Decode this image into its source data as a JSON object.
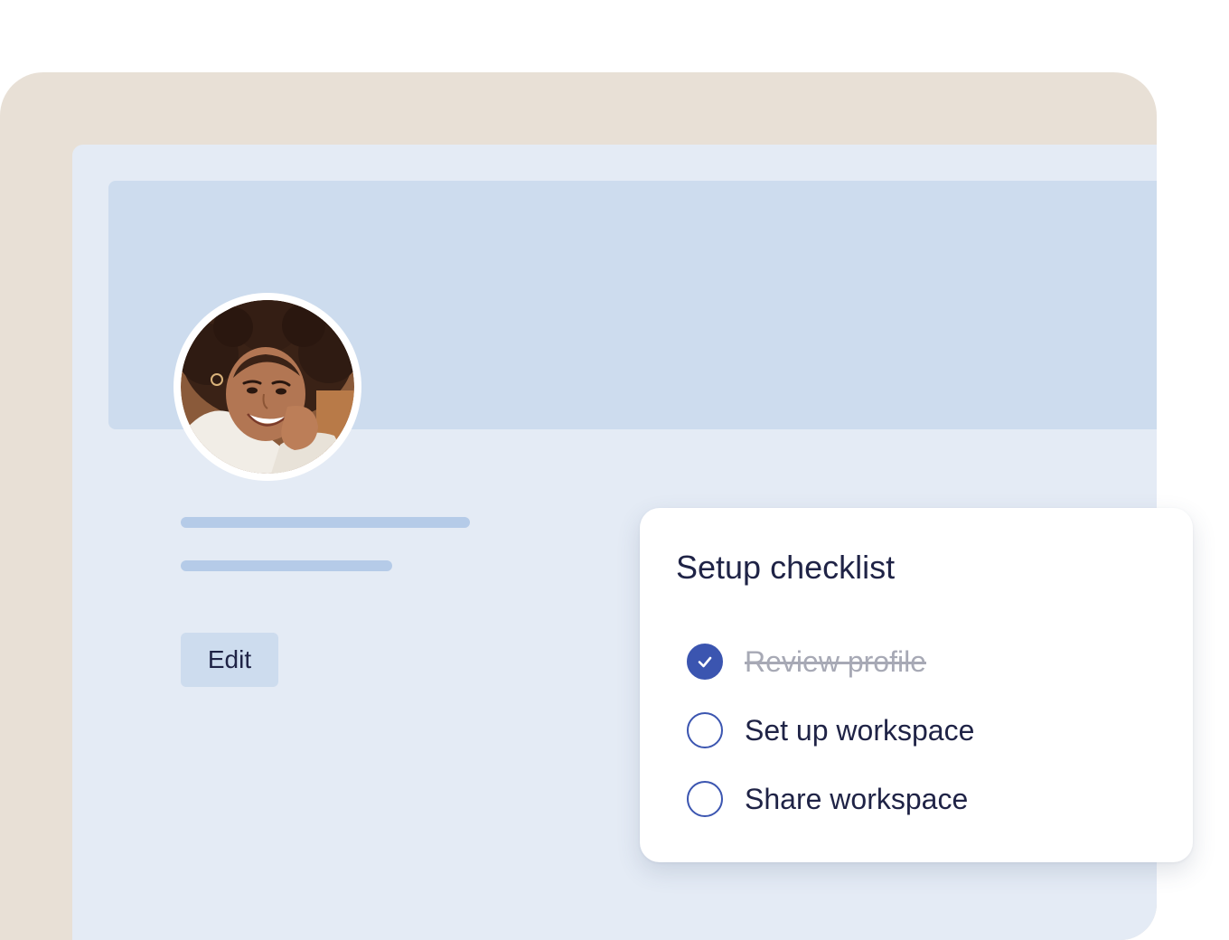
{
  "profile": {
    "avatar_icon": "user-photo-avatar",
    "edit_label": "Edit"
  },
  "checklist": {
    "title": "Setup checklist",
    "items": [
      {
        "label": "Review profile",
        "done": true,
        "icon": "check-icon"
      },
      {
        "label": "Set up workspace",
        "done": false
      },
      {
        "label": "Share workspace",
        "done": false
      }
    ]
  },
  "colors": {
    "outer_frame": "#e8e0d6",
    "app_background": "#e4ebf5",
    "cover_banner": "#cddcee",
    "placeholder_lines": "#b5cbe8",
    "accent": "#3b55b0",
    "text_primary": "#1f2346",
    "text_done": "#a7a9b5"
  }
}
